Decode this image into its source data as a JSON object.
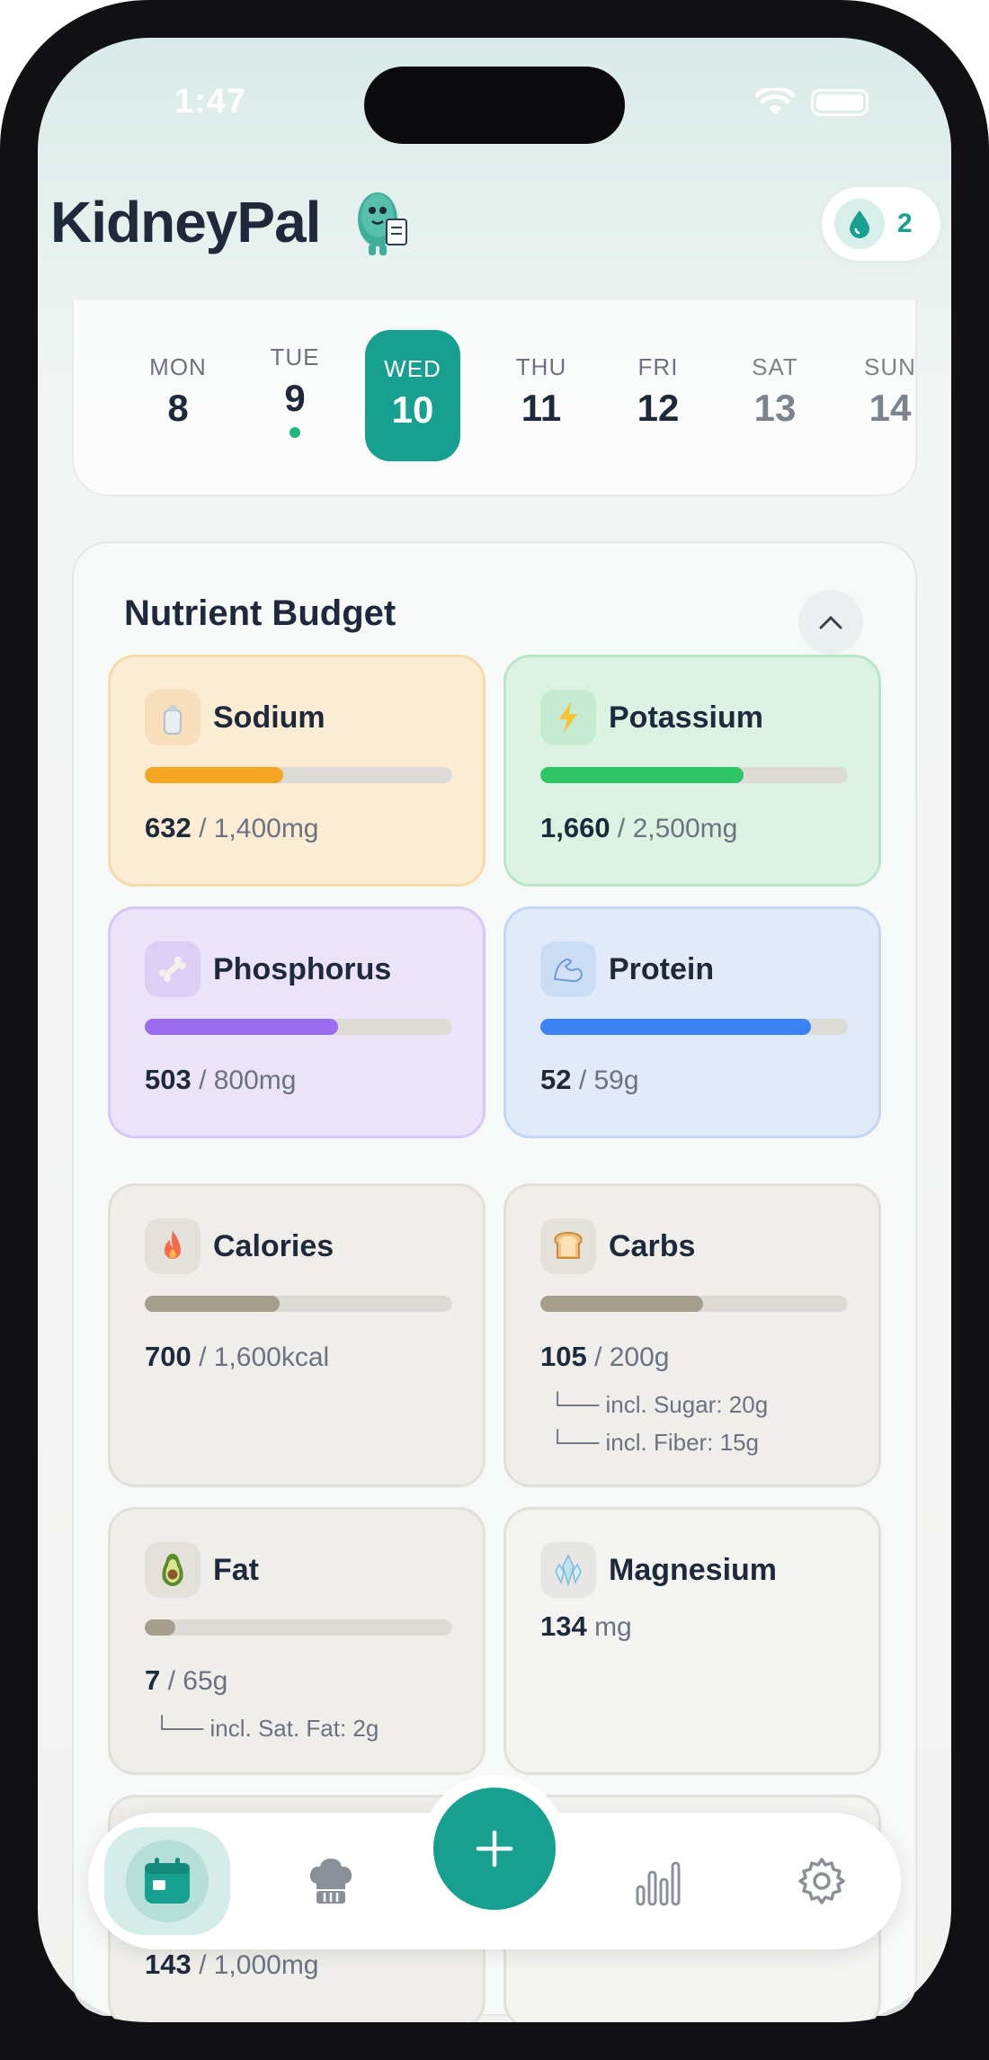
{
  "status_bar": {
    "time": "1:47"
  },
  "header": {
    "app_title": "KidneyPal",
    "water_count": "2"
  },
  "week": [
    {
      "name": "MON",
      "num": "8",
      "state": "normal"
    },
    {
      "name": "TUE",
      "num": "9",
      "state": "dot"
    },
    {
      "name": "WED",
      "num": "10",
      "state": "selected"
    },
    {
      "name": "THU",
      "num": "11",
      "state": "normal"
    },
    {
      "name": "FRI",
      "num": "12",
      "state": "normal"
    },
    {
      "name": "SAT",
      "num": "13",
      "state": "muted"
    },
    {
      "name": "SUN",
      "num": "14",
      "state": "muted"
    }
  ],
  "budget": {
    "title": "Nutrient Budget",
    "tiles": {
      "sodium": {
        "label": "Sodium",
        "current": "632",
        "limit": " / 1,400mg",
        "fill": 0.45,
        "color": "#f5a623"
      },
      "potassium": {
        "label": "Potassium",
        "current": "1,660",
        "limit": " / 2,500mg",
        "fill": 0.66,
        "color": "#2fc667"
      },
      "phosphorus": {
        "label": "Phosphorus",
        "current": "503",
        "limit": " / 800mg",
        "fill": 0.63,
        "color": "#9b6bf0"
      },
      "protein": {
        "label": "Protein",
        "current": "52",
        "limit": " / 59g",
        "fill": 0.88,
        "color": "#3b82f6"
      },
      "calories": {
        "label": "Calories",
        "current": "700",
        "limit": " / 1,600kcal",
        "fill": 0.44,
        "color": "#a69e8c"
      },
      "carbs": {
        "label": "Carbs",
        "current": "105",
        "limit": " / 200g",
        "fill": 0.53,
        "color": "#a69e8c",
        "sub1": "└── incl. Sugar: 20g",
        "sub2": "└── incl. Fiber: 15g"
      },
      "fat": {
        "label": "Fat",
        "current": "7",
        "limit": " / 65g",
        "fill": 0.1,
        "color": "#a69e8c",
        "sub1": "└── incl. Sat. Fat: 2g"
      },
      "magnesium": {
        "label": "Magnesium",
        "current": "134",
        "unit": " mg"
      },
      "partial": {
        "current": "143",
        "limit": " / 1,000mg"
      }
    }
  },
  "icons": {
    "sodium": "salt-shaker-icon",
    "potassium": "lightning-icon",
    "phosphorus": "bone-icon",
    "protein": "flexed-arm-icon",
    "calories": "flame-icon",
    "carbs": "bread-icon",
    "fat": "avocado-icon",
    "magnesium": "crystal-icon"
  },
  "tabbar": {
    "tabs": [
      "calendar-icon",
      "chef-hat-icon",
      "add-icon",
      "bar-chart-icon",
      "gear-icon"
    ],
    "active": "calendar-icon"
  },
  "colors": {
    "accent": "#17a08f"
  }
}
